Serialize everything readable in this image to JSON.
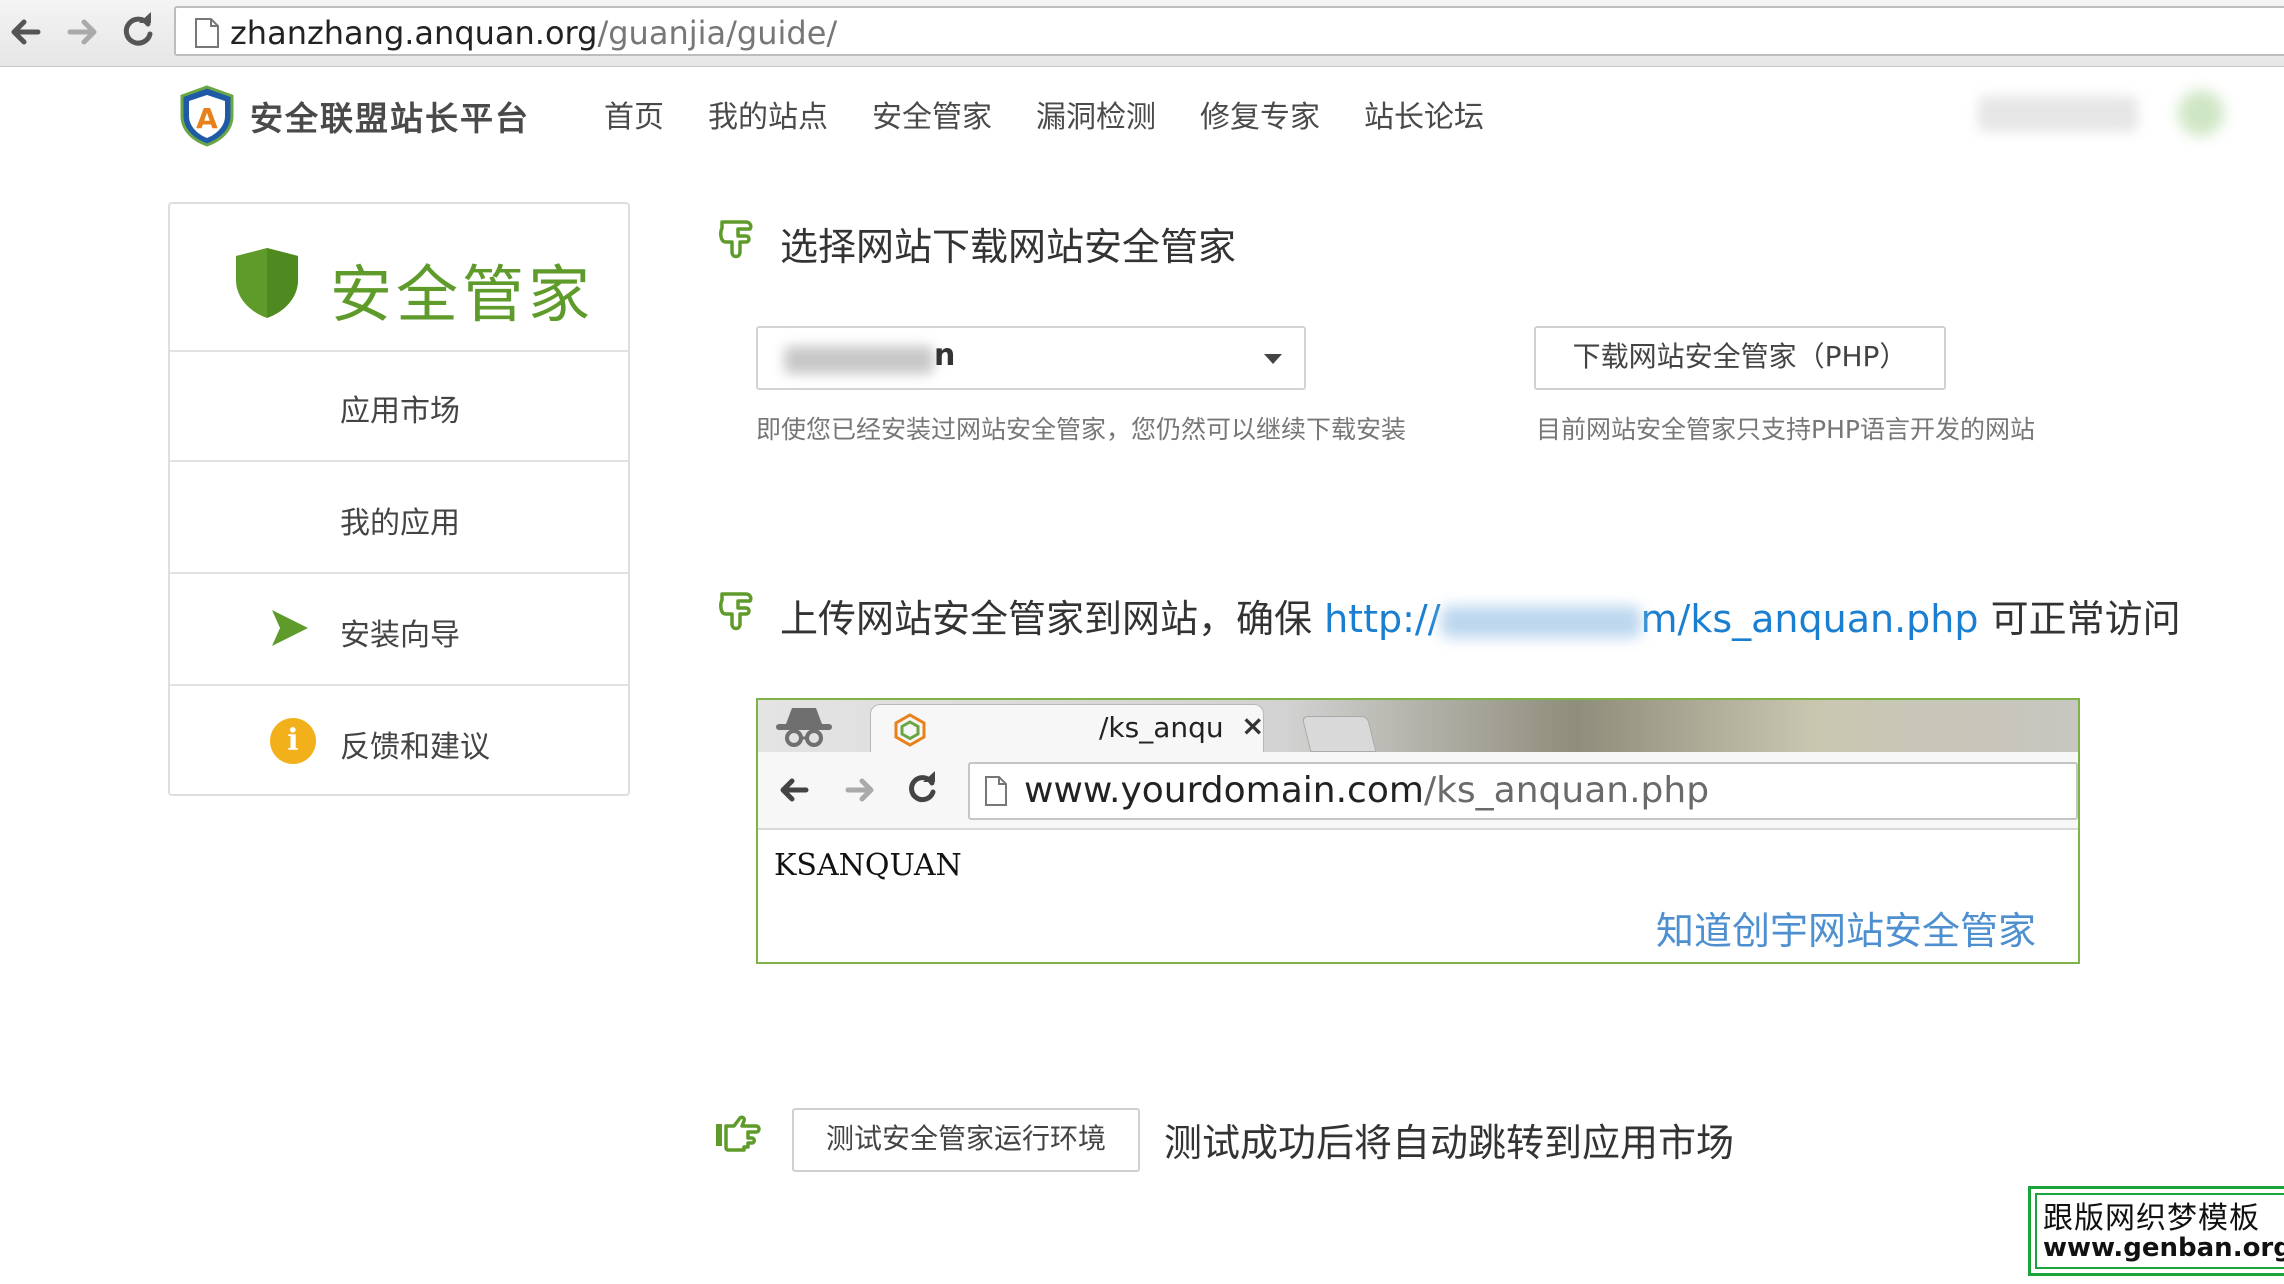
{
  "browser": {
    "url_domain": "zhanzhang.anquan.org",
    "url_path": "/guanjia/guide/",
    "icons": [
      "back-arrow-icon",
      "forward-arrow-icon",
      "reload-icon",
      "page-icon"
    ]
  },
  "site_header": {
    "logo_text": "安全联盟站长平台",
    "nav": [
      "首页",
      "我的站点",
      "安全管家",
      "漏洞检测",
      "修复专家",
      "站长论坛"
    ]
  },
  "sidebar": {
    "title": "安全管家",
    "items": [
      {
        "label": "应用市场"
      },
      {
        "label": "我的应用"
      },
      {
        "label": "安装向导",
        "icon": "arrow-right-icon"
      },
      {
        "label": "反馈和建议",
        "icon": "info-icon",
        "icon_glyph": "i"
      }
    ]
  },
  "step1": {
    "title": "选择网站下载网站安全管家",
    "select_value_tail": "n",
    "select_hint": "即使您已经安装过网站安全管家，您仍然可以继续下载安装",
    "download_button": "下载网站安全管家（PHP）",
    "download_hint": "目前网站安全管家只支持PHP语言开发的网站"
  },
  "step2": {
    "title_prefix": "上传网站安全管家到网站，确保 ",
    "link_start": "http://",
    "link_end": "m/ks_anquan.php",
    "title_suffix": " 可正常访问",
    "demo": {
      "tab_title": "/ks_anqu",
      "tab_close": "×",
      "url_domain": "www.yourdomain.com",
      "url_path": "/ks_anquan.php",
      "body_text": "KSANQUAN",
      "brand_text": "知道创宇网站安全管家"
    }
  },
  "step3": {
    "button": "测试安全管家运行环境",
    "text": "测试成功后将自动跳转到应用市场"
  },
  "watermark": {
    "line1": "跟版网织梦模板",
    "line2": "www.genban.org"
  },
  "colors": {
    "accent_green": "#5e9b2a",
    "link_blue": "#1a7fd0",
    "info_orange": "#f2b01a",
    "demo_border": "#7fb347"
  }
}
